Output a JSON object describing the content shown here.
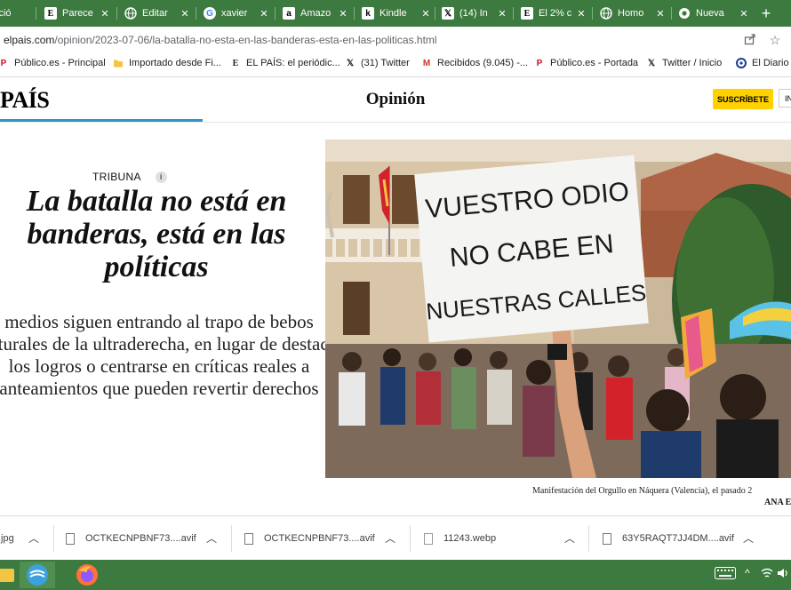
{
  "browser": {
    "tabs": [
      {
        "label": "ició",
        "icon": "page-icon"
      },
      {
        "label": "Parece",
        "icon": "elpais-e-icon"
      },
      {
        "label": "Editar",
        "icon": "globe-icon"
      },
      {
        "label": "xavier",
        "icon": "google-g-icon"
      },
      {
        "label": "Amazo",
        "icon": "amazon-icon"
      },
      {
        "label": "Kindle",
        "icon": "kindle-icon"
      },
      {
        "label": "(14) In",
        "icon": "x-icon"
      },
      {
        "label": "El 2% c",
        "icon": "elpais-e-icon"
      },
      {
        "label": "Homo",
        "icon": "globe-icon"
      },
      {
        "label": "Nueva",
        "icon": "chrome-icon"
      }
    ],
    "address": {
      "domain": "elpais.com",
      "path": "/opinion/2023-07-06/la-batalla-no-esta-en-las-banderas-esta-en-las-politicas.html"
    },
    "bookmarks": [
      {
        "label": "Público.es - Principal",
        "icon": "publico-icon"
      },
      {
        "label": "Importado desde Fi...",
        "icon": "folder-icon"
      },
      {
        "label": "EL PAÍS: el periódic...",
        "icon": "elpais-e-icon"
      },
      {
        "label": "(31) Twitter",
        "icon": "x-icon"
      },
      {
        "label": "Recibidos (9.045) -...",
        "icon": "gmail-icon"
      },
      {
        "label": "Público.es - Portada",
        "icon": "publico-icon"
      },
      {
        "label": "Twitter / Inicio",
        "icon": "x-icon"
      },
      {
        "label": "El Diario",
        "icon": "eldiario-icon"
      }
    ]
  },
  "site": {
    "logo": "PAÍS",
    "section": "Opinión",
    "subscribe_label": "SUSCRÍBETE",
    "login_label": "IN"
  },
  "article": {
    "kicker": "TRIBUNA",
    "info_symbol": "i",
    "headline": "La batalla no está en banderas, está en las políticas",
    "dek": "medios siguen entrando al trapo de bebos culturales de la ultraderecha, en lugar de destacar los logros o centrarse en críticas reales a anteamientos que pueden revertir derechos",
    "caption": "Manifestación del Orgullo en Náquera (Valencia), el pasado 2",
    "credit": "ANA E",
    "sign_lines": [
      "VUESTRO ODIO",
      "NO CABE EN",
      "NUESTRAS CALLES"
    ]
  },
  "downloads": [
    {
      "name": ".jpg"
    },
    {
      "name": "OCTKECNPBNF73....avif"
    },
    {
      "name": "OCTKECNPBNF73....avif"
    },
    {
      "name": "11243.webp"
    },
    {
      "name": "63Y5RAQT7JJ4DM....avif"
    }
  ],
  "colors": {
    "chrome_green": "#3c7a3f",
    "subscribe_yellow": "#ffd100",
    "progress_blue": "#2e95c9"
  }
}
